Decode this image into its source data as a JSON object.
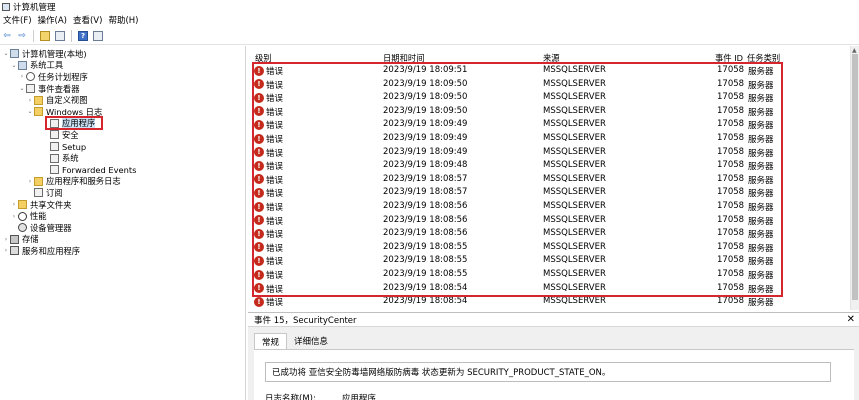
{
  "window": {
    "title": "计算机管理"
  },
  "menu": [
    "文件(F)",
    "操作(A)",
    "查看(V)",
    "帮助(H)"
  ],
  "toolbar": {
    "icons": [
      "back-arrow-icon",
      "forward-arrow-icon",
      "up-folder-icon",
      "show-hide-tree-icon",
      "help-icon",
      "properties-icon"
    ],
    "help_glyph": "?"
  },
  "tree": [
    {
      "label": "计算机管理(本地)",
      "arrow": "⌄",
      "icon": "pc"
    },
    {
      "label": "系统工具",
      "arrow": "⌄",
      "icon": "pc"
    },
    {
      "label": "任务计划程序",
      "arrow": "›",
      "icon": "clock"
    },
    {
      "label": "事件查看器",
      "arrow": "⌄",
      "icon": "log"
    },
    {
      "label": "自定义视图",
      "arrow": "›",
      "icon": "folder"
    },
    {
      "label": "Windows 日志",
      "arrow": "⌄",
      "icon": "folder"
    },
    {
      "label": "应用程序",
      "arrow": "",
      "icon": "log"
    },
    {
      "label": "安全",
      "arrow": "",
      "icon": "log"
    },
    {
      "label": "Setup",
      "arrow": "",
      "icon": "log"
    },
    {
      "label": "系统",
      "arrow": "",
      "icon": "log"
    },
    {
      "label": "Forwarded Events",
      "arrow": "",
      "icon": "log"
    },
    {
      "label": "应用程序和服务日志",
      "arrow": "›",
      "icon": "folder"
    },
    {
      "label": "订阅",
      "arrow": "",
      "icon": "log"
    },
    {
      "label": "共享文件夹",
      "arrow": "›",
      "icon": "folder"
    },
    {
      "label": "性能",
      "arrow": "›",
      "icon": "nope"
    },
    {
      "label": "设备管理器",
      "arrow": "",
      "icon": "gear"
    },
    {
      "label": "存储",
      "arrow": "›",
      "icon": "disk"
    },
    {
      "label": "服务和应用程序",
      "arrow": "›",
      "icon": "svc"
    }
  ],
  "list": {
    "columns": [
      "级别",
      "日期和时间",
      "来源",
      "事件 ID",
      "任务类别"
    ],
    "rows": [
      {
        "level": "错误",
        "datetime": "2023/9/19 18:09:51",
        "source": "MSSQLSERVER",
        "id": "17058",
        "category": "服务器"
      },
      {
        "level": "错误",
        "datetime": "2023/9/19 18:09:50",
        "source": "MSSQLSERVER",
        "id": "17058",
        "category": "服务器"
      },
      {
        "level": "错误",
        "datetime": "2023/9/19 18:09:50",
        "source": "MSSQLSERVER",
        "id": "17058",
        "category": "服务器"
      },
      {
        "level": "错误",
        "datetime": "2023/9/19 18:09:50",
        "source": "MSSQLSERVER",
        "id": "17058",
        "category": "服务器"
      },
      {
        "level": "错误",
        "datetime": "2023/9/19 18:09:49",
        "source": "MSSQLSERVER",
        "id": "17058",
        "category": "服务器"
      },
      {
        "level": "错误",
        "datetime": "2023/9/19 18:09:49",
        "source": "MSSQLSERVER",
        "id": "17058",
        "category": "服务器"
      },
      {
        "level": "错误",
        "datetime": "2023/9/19 18:09:49",
        "source": "MSSQLSERVER",
        "id": "17058",
        "category": "服务器"
      },
      {
        "level": "错误",
        "datetime": "2023/9/19 18:09:48",
        "source": "MSSQLSERVER",
        "id": "17058",
        "category": "服务器"
      },
      {
        "level": "错误",
        "datetime": "2023/9/19 18:08:57",
        "source": "MSSQLSERVER",
        "id": "17058",
        "category": "服务器"
      },
      {
        "level": "错误",
        "datetime": "2023/9/19 18:08:57",
        "source": "MSSQLSERVER",
        "id": "17058",
        "category": "服务器"
      },
      {
        "level": "错误",
        "datetime": "2023/9/19 18:08:56",
        "source": "MSSQLSERVER",
        "id": "17058",
        "category": "服务器"
      },
      {
        "level": "错误",
        "datetime": "2023/9/19 18:08:56",
        "source": "MSSQLSERVER",
        "id": "17058",
        "category": "服务器"
      },
      {
        "level": "错误",
        "datetime": "2023/9/19 18:08:56",
        "source": "MSSQLSERVER",
        "id": "17058",
        "category": "服务器"
      },
      {
        "level": "错误",
        "datetime": "2023/9/19 18:08:55",
        "source": "MSSQLSERVER",
        "id": "17058",
        "category": "服务器"
      },
      {
        "level": "错误",
        "datetime": "2023/9/19 18:08:55",
        "source": "MSSQLSERVER",
        "id": "17058",
        "category": "服务器"
      },
      {
        "level": "错误",
        "datetime": "2023/9/19 18:08:55",
        "source": "MSSQLSERVER",
        "id": "17058",
        "category": "服务器"
      },
      {
        "level": "错误",
        "datetime": "2023/9/19 18:08:54",
        "source": "MSSQLSERVER",
        "id": "17058",
        "category": "服务器"
      },
      {
        "level": "错误",
        "datetime": "2023/9/19 18:08:54",
        "source": "MSSQLSERVER",
        "id": "17058",
        "category": "服务器"
      }
    ],
    "error_glyph": "!"
  },
  "detail": {
    "title": "事件 15，SecurityCenter",
    "close": "✕",
    "tabs": [
      "常规",
      "详细信息"
    ],
    "message": "已成功将 亚信安全防毒墙网络版防病毒 状态更新为 SECURITY_PRODUCT_STATE_ON。",
    "log_name_label": "日志名称(M):",
    "log_name_value": "应用程序"
  },
  "colors": {
    "highlight_frame": "#d6262d",
    "error": "#c42b1c",
    "selection": "#cce4f7"
  }
}
